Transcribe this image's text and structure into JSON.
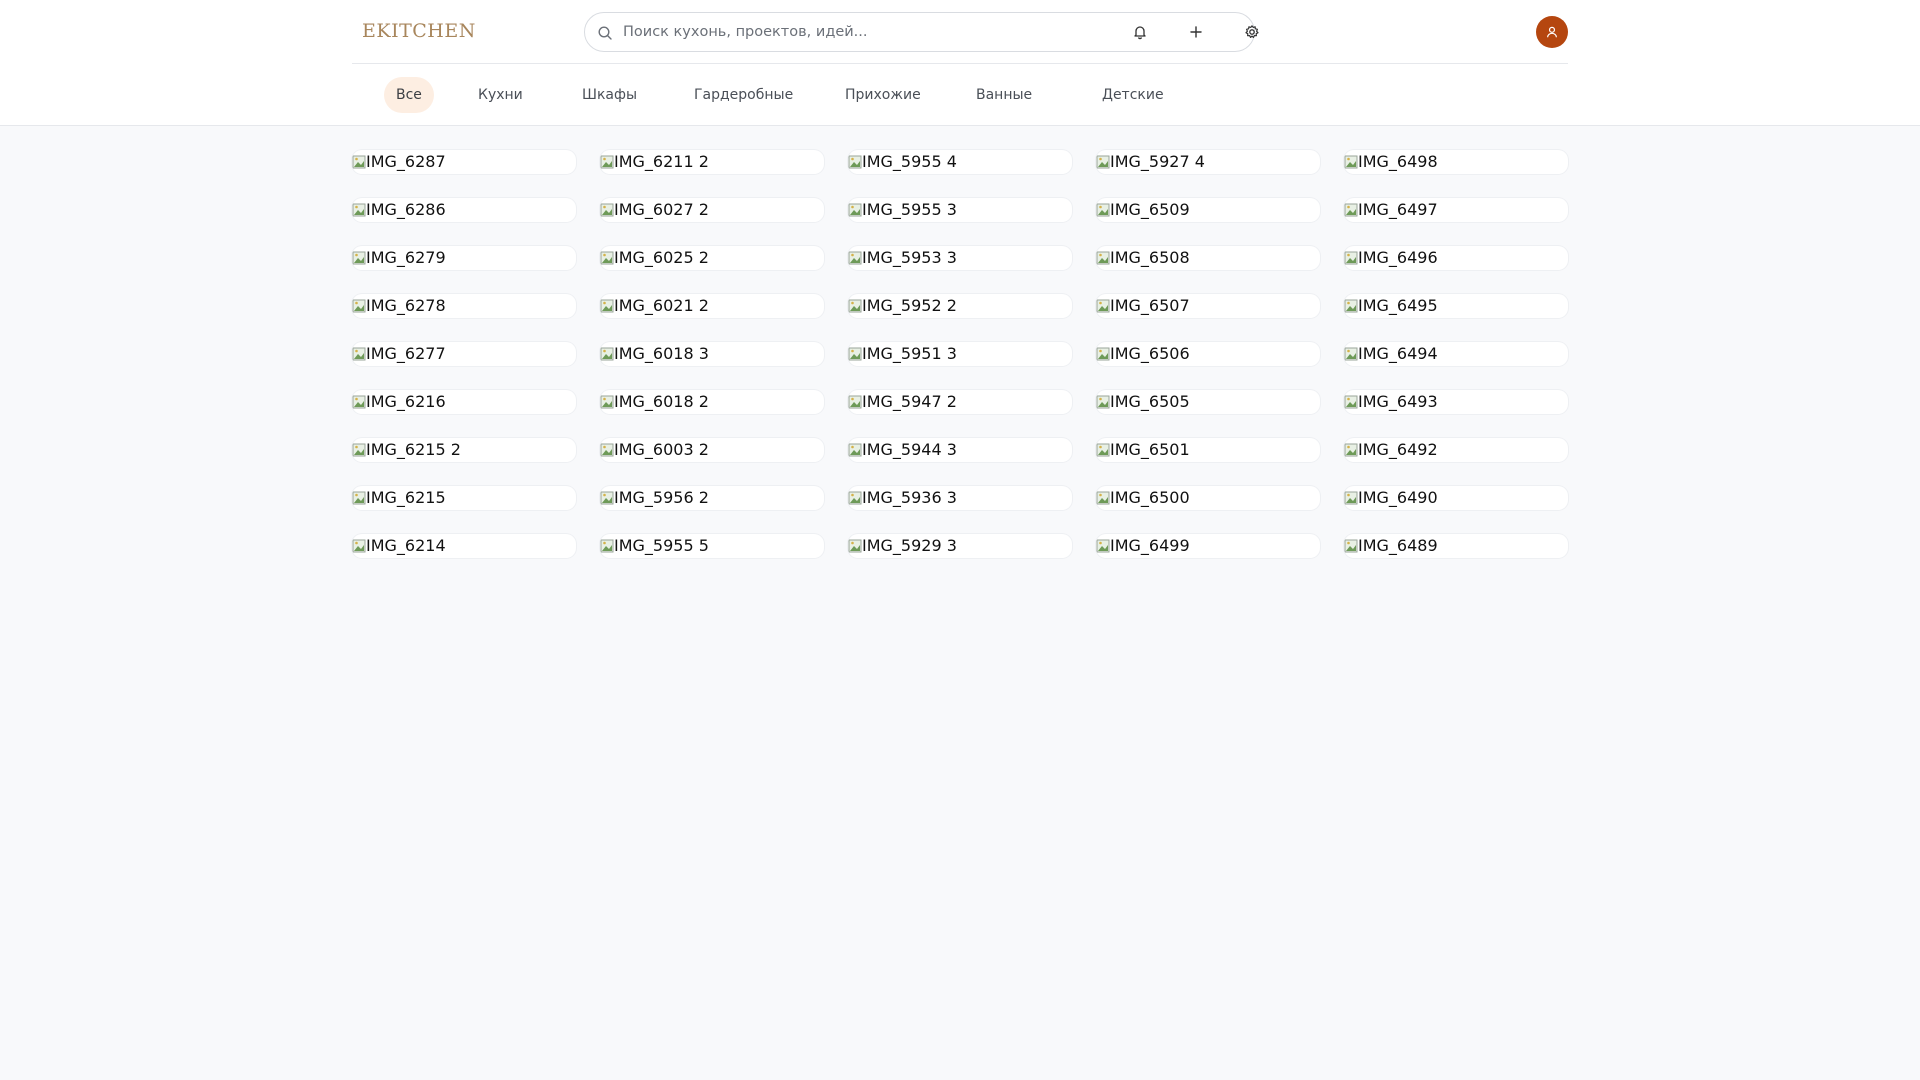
{
  "header": {
    "logo": "EKITCHEN",
    "search_placeholder": "Поиск кухонь, проектов, идей...",
    "icons": [
      "bell-icon",
      "plus-icon",
      "gear-icon",
      "user-icon"
    ],
    "avatar_color": "#b5460f",
    "logo_color": "#a8865c"
  },
  "categories": [
    "Все",
    "Кухни",
    "Шкафы",
    "Гардеробные",
    "Прихожие",
    "Ванные",
    "Детские"
  ],
  "active_category": "Все",
  "columns": [
    [
      "IMG_6287",
      "IMG_6286",
      "IMG_6279",
      "IMG_6278",
      "IMG_6277",
      "IMG_6216",
      "IMG_6215 2",
      "IMG_6215",
      "IMG_6214"
    ],
    [
      "IMG_6211 2",
      "IMG_6027 2",
      "IMG_6025 2",
      "IMG_6021 2",
      "IMG_6018 3",
      "IMG_6018 2",
      "IMG_6003 2",
      "IMG_5956 2",
      "IMG_5955 5"
    ],
    [
      "IMG_5955 4",
      "IMG_5955 3",
      "IMG_5953 3",
      "IMG_5952 2",
      "IMG_5951 3",
      "IMG_5947 2",
      "IMG_5944 3",
      "IMG_5936 3",
      "IMG_5929 3"
    ],
    [
      "IMG_5927 4",
      "IMG_6509",
      "IMG_6508",
      "IMG_6507",
      "IMG_6506",
      "IMG_6505",
      "IMG_6501",
      "IMG_6500",
      "IMG_6499"
    ],
    [
      "IMG_6498",
      "IMG_6497",
      "IMG_6496",
      "IMG_6495",
      "IMG_6494",
      "IMG_6493",
      "IMG_6492",
      "IMG_6490",
      "IMG_6489"
    ]
  ]
}
